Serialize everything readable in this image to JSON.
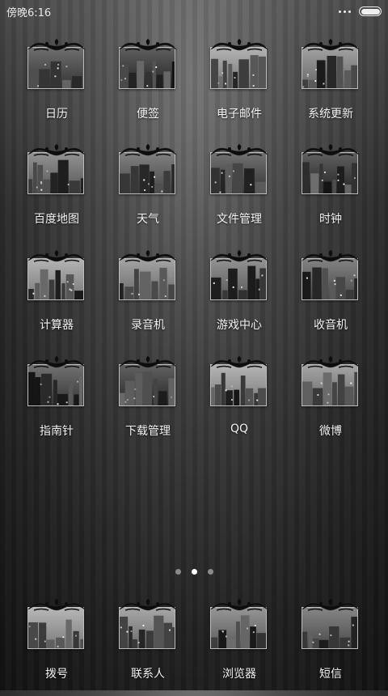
{
  "status_bar": {
    "time": "傍晚6:16",
    "menu_icon": "more-dots-icon",
    "battery_icon": "battery-icon",
    "battery_level": 1.0
  },
  "apps": [
    {
      "label": "日历",
      "icon": "city-street-photo"
    },
    {
      "label": "便签",
      "icon": "alley-photo"
    },
    {
      "label": "电子邮件",
      "icon": "tram-street-photo"
    },
    {
      "label": "系统更新",
      "icon": "aerial-city-photo"
    },
    {
      "label": "百度地图",
      "icon": "coastal-path-photo"
    },
    {
      "label": "天气",
      "icon": "cable-car-photo"
    },
    {
      "label": "文件管理",
      "icon": "skyline-tower-photo"
    },
    {
      "label": "时钟",
      "icon": "night-skyline-photo"
    },
    {
      "label": "计算器",
      "icon": "train-photo"
    },
    {
      "label": "录音机",
      "icon": "crowd-photo"
    },
    {
      "label": "游戏中心",
      "icon": "cathedral-photo"
    },
    {
      "label": "收音机",
      "icon": "lake-island-photo"
    },
    {
      "label": "指南针",
      "icon": "harbor-town-photo"
    },
    {
      "label": "下载管理",
      "icon": "house-photo"
    },
    {
      "label": "QQ",
      "icon": "waterfront-skyline-photo"
    },
    {
      "label": "微博",
      "icon": "old-street-photo"
    }
  ],
  "pager": {
    "pages": 3,
    "active_page": 2
  },
  "dock": [
    {
      "label": "拨号",
      "icon": "boat-canal-photo"
    },
    {
      "label": "联系人",
      "icon": "plaza-photo"
    },
    {
      "label": "浏览器",
      "icon": "mountain-photo"
    },
    {
      "label": "短信",
      "icon": "city-towers-photo"
    }
  ]
}
